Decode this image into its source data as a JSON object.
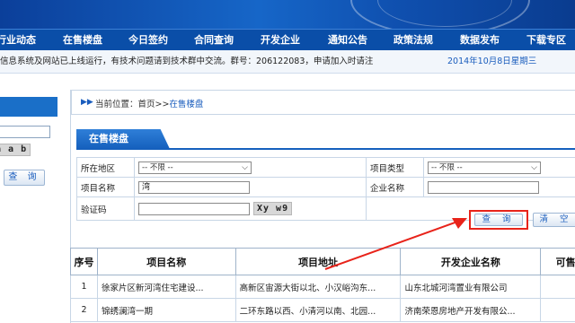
{
  "nav": {
    "items": [
      "行业动态",
      "在售楼盘",
      "今日签约",
      "合同查询",
      "开发企业",
      "通知公告",
      "政策法规",
      "数据发布",
      "下载专区"
    ]
  },
  "ticker": {
    "text": "信息系统及网站已上线运行，有技术问题请到技术群中交流。群号：206122083，申请加入时请注",
    "date": "2014年10月8日星期三"
  },
  "left": {
    "captcha": "a a b",
    "query_label": "查 询"
  },
  "breadcrumb": {
    "prefix": "当前位置：首页>>",
    "current": "在售楼盘"
  },
  "section": {
    "title": "在售楼盘"
  },
  "form": {
    "region_label": "所在地区",
    "region_value": "-- 不限 --",
    "project_type_label": "项目类型",
    "project_type_value": "-- 不限 --",
    "project_name_label": "项目名称",
    "project_name_value": "湾",
    "company_label": "企业名称",
    "company_value": "",
    "captcha_label": "验证码",
    "captcha_value": "",
    "captcha_code": "Xy w9",
    "query_button": "查 询",
    "clear_button": "清 空"
  },
  "results": {
    "headers": [
      "序号",
      "项目名称",
      "项目地址",
      "开发企业名称",
      "可售"
    ],
    "rows": [
      [
        "1",
        "徐家片区新河湾住宅建设...",
        "高新区宙源大街以北、小汉峪沟东...",
        "山东北城河湾置业有限公司",
        ""
      ],
      [
        "2",
        "锦绣澜湾一期",
        "二环东路以西、小清河以南、北园...",
        "济南荣恩房地产开发有限公...",
        ""
      ]
    ]
  },
  "colors": {
    "nav_bg": "#0a4ea8",
    "accent": "#1560bd",
    "highlight": "#e8231a"
  }
}
